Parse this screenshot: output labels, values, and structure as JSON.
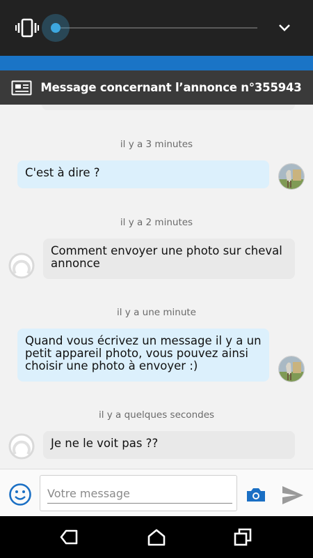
{
  "volume": {
    "level": 0.0
  },
  "header": {
    "title": "Message concernant l’annonce n°355943"
  },
  "messages": [
    {
      "timestamp": "il y a 3 minutes",
      "text": "C'est à dire ?",
      "sender": "me"
    },
    {
      "timestamp": "il y a 2 minutes",
      "text": "Comment envoyer une photo sur cheval annonce",
      "sender": "them"
    },
    {
      "timestamp": "il y a une minute",
      "text": "Quand vous écrivez un message il y a un petit appareil photo, vous pouvez ainsi choisir une photo à envoyer :)",
      "sender": "me"
    },
    {
      "timestamp": "il y a quelques secondes",
      "text": "Je ne le voit pas ??",
      "sender": "them"
    }
  ],
  "composer": {
    "placeholder": "Votre message",
    "value": ""
  },
  "colors": {
    "accent": "#3da8e0",
    "bar_blue": "#1a74c6",
    "header_bg": "#3a3a3a",
    "bubble_me": "#dcf0fc",
    "bubble_them": "#e9e9e9",
    "icon_blue": "#1a6fc4"
  },
  "icons": [
    "vibrate-icon",
    "chevron-down-icon",
    "newspaper-icon",
    "emoji-icon",
    "camera-icon",
    "send-icon",
    "back-icon",
    "home-icon",
    "recent-apps-icon"
  ]
}
